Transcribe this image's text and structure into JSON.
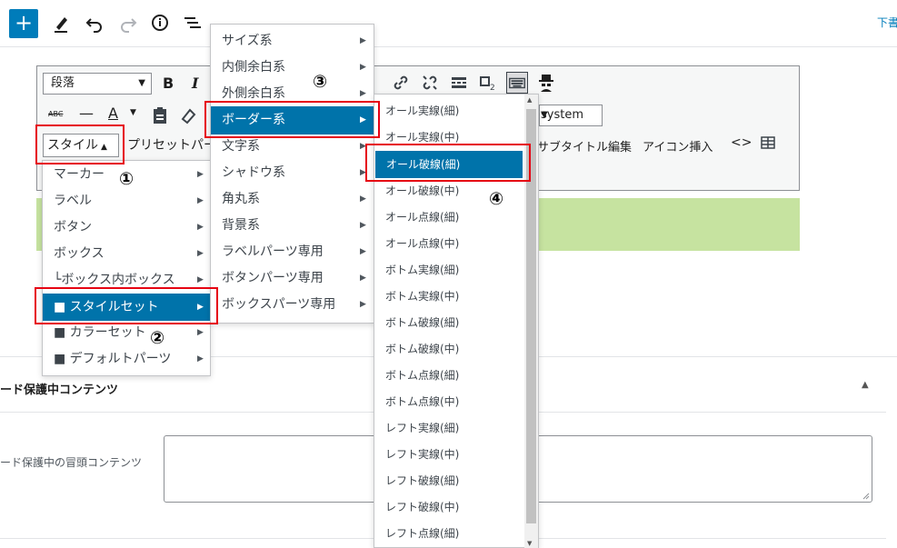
{
  "topbar": {
    "add_label": "+",
    "draft_label": "下書"
  },
  "editor": {
    "format_select": "段落",
    "bold": "B",
    "italic": "I",
    "strike": "ABC",
    "hr": "—",
    "color_letter": "A",
    "font_value": "system",
    "style_button": "スタイル",
    "preset_label": "プリセットパー",
    "subtitle_edit": "サブタイトル編集",
    "icon_insert": "アイコン挿入",
    "code": "<>"
  },
  "panel": {
    "title": "ード保護中コンテンツ",
    "field_label": "ード保護中の冒頭コンテンツ"
  },
  "menu1": {
    "items": [
      {
        "label": "マーカー"
      },
      {
        "label": "ラベル"
      },
      {
        "label": "ボタン"
      },
      {
        "label": "ボックス"
      },
      {
        "label": "└ボックス内ボックス"
      },
      {
        "label": "■ スタイルセット"
      },
      {
        "label": "■ カラーセット"
      },
      {
        "label": "■ デフォルトパーツ"
      }
    ]
  },
  "menu2": {
    "items": [
      {
        "label": "サイズ系"
      },
      {
        "label": "内側余白系"
      },
      {
        "label": "外側余白系"
      },
      {
        "label": "ボーダー系"
      },
      {
        "label": "文字系"
      },
      {
        "label": "シャドウ系"
      },
      {
        "label": "角丸系"
      },
      {
        "label": "背景系"
      },
      {
        "label": "ラベルパーツ専用"
      },
      {
        "label": "ボタンパーツ専用"
      },
      {
        "label": "ボックスパーツ専用"
      }
    ]
  },
  "menu3": {
    "items": [
      {
        "label": "オール実線(細)"
      },
      {
        "label": "オール実線(中)"
      },
      {
        "label": "オール破線(細)"
      },
      {
        "label": "オール破線(中)"
      },
      {
        "label": "オール点線(細)"
      },
      {
        "label": "オール点線(中)"
      },
      {
        "label": "ボトム実線(細)"
      },
      {
        "label": "ボトム実線(中)"
      },
      {
        "label": "ボトム破線(細)"
      },
      {
        "label": "ボトム破線(中)"
      },
      {
        "label": "ボトム点線(細)"
      },
      {
        "label": "ボトム点線(中)"
      },
      {
        "label": "レフト実線(細)"
      },
      {
        "label": "レフト実線(中)"
      },
      {
        "label": "レフト破線(細)"
      },
      {
        "label": "レフト破線(中)"
      },
      {
        "label": "レフト点線(細)"
      }
    ]
  },
  "annotations": {
    "step1": "①",
    "step2": "②",
    "step3": "③",
    "step4": "④"
  },
  "colors": {
    "accent": "#007cba",
    "menu_active": "#0073aa",
    "highlight": "#e60012",
    "green_block": "#c6e3a0"
  }
}
